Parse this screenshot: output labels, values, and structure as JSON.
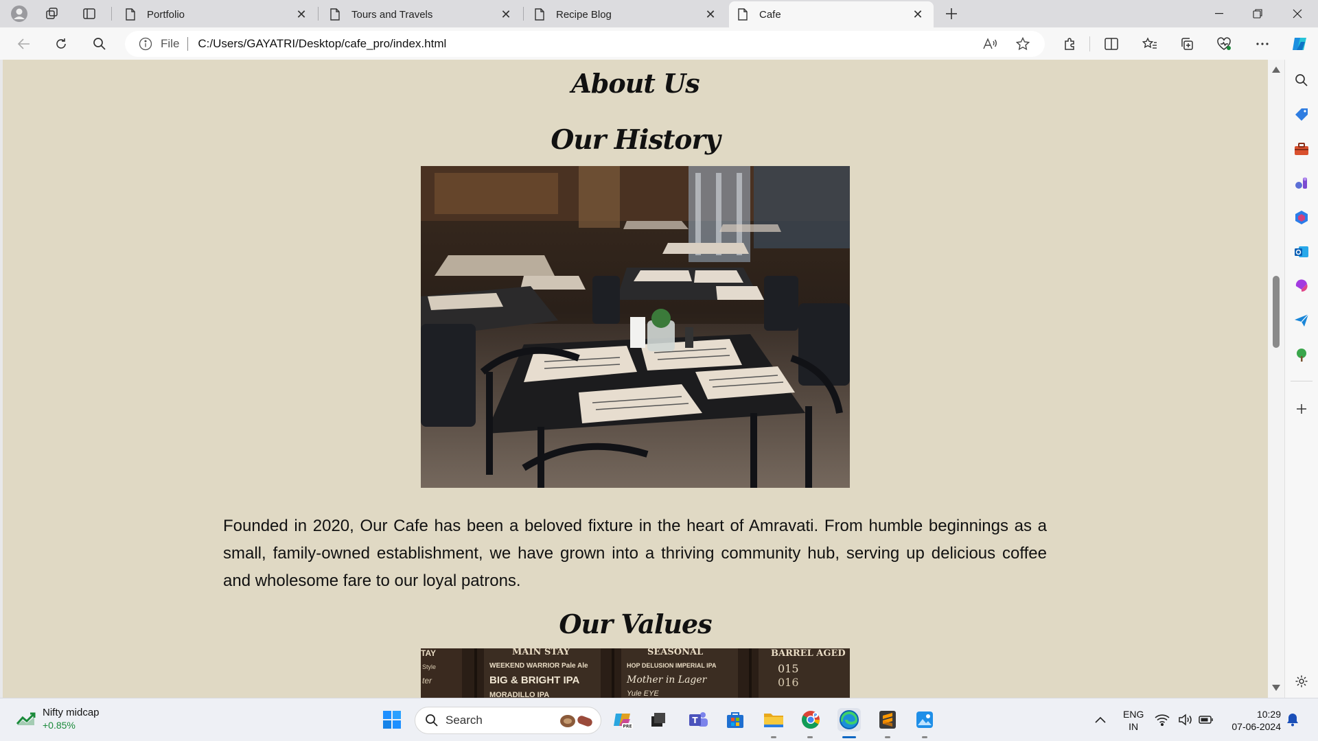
{
  "browser": {
    "tabs": [
      {
        "label": "Portfolio"
      },
      {
        "label": "Tours and Travels"
      },
      {
        "label": "Recipe Blog"
      },
      {
        "label": "Cafe"
      }
    ],
    "active_tab": "Cafe",
    "address": {
      "scheme_label": "File",
      "url": "C:/Users/GAYATRI/Desktop/cafe_pro/index.html"
    }
  },
  "page": {
    "title": "About Us",
    "history": {
      "heading": "Our History",
      "paragraph": "Founded in 2020, Our Cafe has been a beloved fixture in the heart of Amravati. From humble beginnings as a small, family-owned establishment, we have grown into a thriving community hub, serving up delicious coffee and wholesome fare to our loyal patrons."
    },
    "values": {
      "heading": "Our Values",
      "board": {
        "col1_header": "TAY",
        "col2_header": "MAIN STAY",
        "col3_header": "SEASONAL",
        "col4_header": "BARREL AGED",
        "line1": "WEEKEND WARRIOR Pale Ale",
        "line2": "BIG & BRIGHT IPA",
        "line3": "HOP DELUSION IMPERIAL IPA",
        "line4": "Mother in Lager",
        "line5": "015",
        "line6": "016",
        "line7": "Style",
        "line8": "ter",
        "line9": "MORADILLO IPA",
        "line10": "Yule EYE"
      }
    }
  },
  "taskbar": {
    "widget": {
      "title": "Nifty midcap",
      "change": "+0.85%"
    },
    "search_label": "Search",
    "language": {
      "line1": "ENG",
      "line2": "IN"
    },
    "clock": {
      "time": "10:29",
      "date": "07-06-2024"
    }
  },
  "colors": {
    "page_background": "#e0d9c4",
    "edge_accent": "#0a66c2",
    "widget_positive": "#1a8a3a"
  }
}
